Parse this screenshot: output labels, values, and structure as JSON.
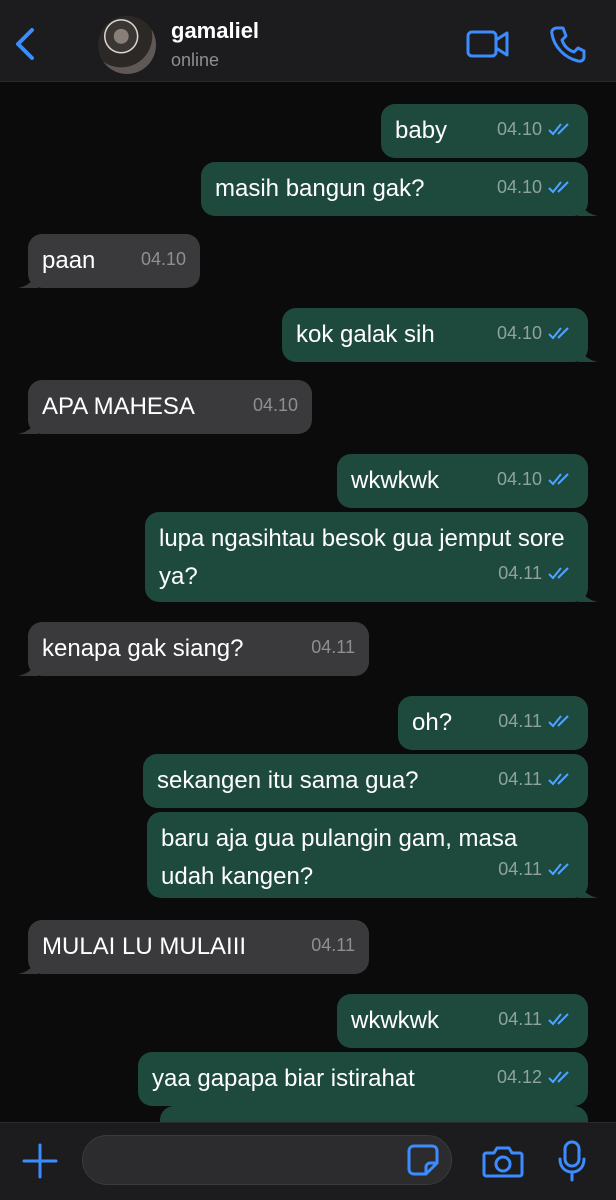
{
  "header": {
    "back_icon": "chevron-left-icon",
    "contact_name": "gamaliel",
    "contact_status": "online",
    "video_icon": "video-camera-icon",
    "call_icon": "phone-icon"
  },
  "colors": {
    "accent": "#3b8cff",
    "outgoing_bubble": "#1e4a3e",
    "incoming_bubble": "#3a3a3c",
    "read_ticks": "#4fa3ff"
  },
  "messages": [
    {
      "dir": "out",
      "text": "baby",
      "time": "04.10",
      "status": "read"
    },
    {
      "dir": "out",
      "text": "masih bangun gak?",
      "time": "04.10",
      "status": "read"
    },
    {
      "dir": "in",
      "text": "paan",
      "time": "04.10"
    },
    {
      "dir": "out",
      "text": "kok galak sih",
      "time": "04.10",
      "status": "read"
    },
    {
      "dir": "in",
      "text": "APA MAHESA",
      "time": "04.10"
    },
    {
      "dir": "out",
      "text": "wkwkwk",
      "time": "04.10",
      "status": "read"
    },
    {
      "dir": "out",
      "text": "lupa ngasihtau besok gua jemput sore ya?",
      "time": "04.11",
      "status": "read"
    },
    {
      "dir": "in",
      "text": "kenapa gak siang?",
      "time": "04.11"
    },
    {
      "dir": "out",
      "text": "oh?",
      "time": "04.11",
      "status": "read"
    },
    {
      "dir": "out",
      "text": "sekangen itu sama gua?",
      "time": "04.11",
      "status": "read"
    },
    {
      "dir": "out",
      "text": "baru aja gua pulangin gam, masa udah kangen?",
      "time": "04.11",
      "status": "read"
    },
    {
      "dir": "in",
      "text": "MULAI LU MULAIII",
      "time": "04.11"
    },
    {
      "dir": "out",
      "text": "wkwkwk",
      "time": "04.11",
      "status": "read"
    },
    {
      "dir": "out",
      "text": "yaa gapapa biar istirahat",
      "time": "04.12",
      "status": "read"
    }
  ],
  "input_bar": {
    "plus_icon": "plus-icon",
    "placeholder": "",
    "sticker_icon": "sticker-icon",
    "camera_icon": "camera-icon",
    "mic_icon": "microphone-icon"
  }
}
